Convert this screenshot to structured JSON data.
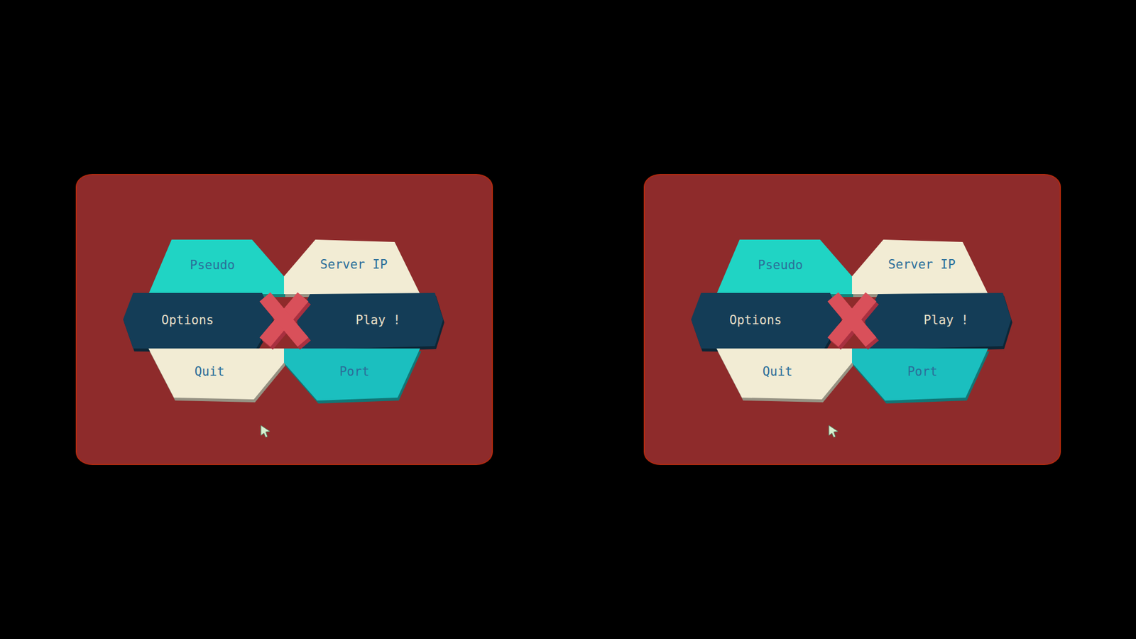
{
  "menu": {
    "items": [
      {
        "label": "Pseudo",
        "kind": "field",
        "color": "#20d4c4"
      },
      {
        "label": "Server IP",
        "kind": "field",
        "color": "#f2ecd4"
      },
      {
        "label": "Options",
        "kind": "bar",
        "color": "#143d57"
      },
      {
        "label": "Play !",
        "kind": "bar",
        "color": "#143d57"
      },
      {
        "label": "Quit",
        "kind": "field",
        "color": "#f2ecd4"
      },
      {
        "label": "Port",
        "kind": "field",
        "color": "#1bbfbf"
      }
    ]
  }
}
